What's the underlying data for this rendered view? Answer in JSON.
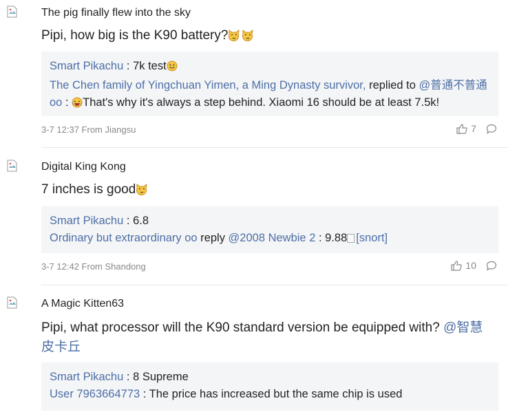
{
  "comments": [
    {
      "username": "The pig finally flew into the sky",
      "text": "Pipi, how big is the K90 battery?",
      "reply1_author": "Smart Pikachu",
      "reply1_colon": " : ",
      "reply1_text": "7k test",
      "reply2_author": "The Chen family of Yingchuan Yimen, a Ming Dynasty survivor,",
      "reply2_verb": " replied to ",
      "reply2_target": "@普通不普通oo",
      "reply2_colon": " : ",
      "reply2_text": "That's why it's always a step behind. Xiaomi 16 should be at least 7.5k!",
      "meta": "3-7 12:37 From Jiangsu",
      "likes": "7"
    },
    {
      "username": "Digital King Kong",
      "text": "7 inches is good",
      "reply1_author": "Smart Pikachu",
      "reply1_colon": " : ",
      "reply1_text": "6.8",
      "reply2_author": "Ordinary but extraordinary oo",
      "reply2_verb": " reply ",
      "reply2_target": "@2008 Newbie 2",
      "reply2_colon": " : ",
      "reply2_text": "9.88",
      "reply2_img_alt": "[snort]",
      "meta": "3-7 12:42 From Shandong",
      "likes": "10"
    },
    {
      "username": "A Magic Kitten63",
      "text": "Pipi, what processor will the K90 standard version be equipped with? ",
      "mention": "@智慧皮卡丘",
      "reply1_author": "Smart Pikachu",
      "reply1_colon": " : ",
      "reply1_text": "8 Supreme",
      "reply2_author": "User 7963664773",
      "reply2_colon": " : ",
      "reply2_text": "The price has increased but the same chip is used"
    }
  ],
  "icons": {
    "avatar": "broken-image-icon",
    "like": "thumbs-up-icon",
    "comment": "comment-bubble-icon",
    "emoji_cat": "cat-face-emoji-icon",
    "emoji_smile": "smile-emoji-icon",
    "emoji_laugh": "laugh-emoji-icon"
  },
  "colors": {
    "link": "#4d6fa6",
    "meta": "#888888",
    "reply_bg": "#f4f5f7"
  }
}
